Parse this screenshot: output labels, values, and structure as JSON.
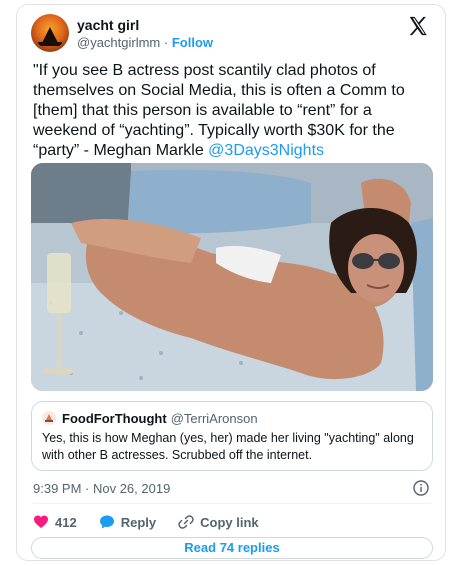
{
  "author": {
    "name": "yacht girl",
    "handle": "@yachtgirlmm",
    "separator": "·",
    "follow_label": "Follow"
  },
  "tweet": {
    "text": "\"If you see B actress post scantily clad photos of themselves on Social Media, this is often a Comm to [them] that this person is available to “rent” for a weekend of “yachting”. Typically worth $30K for the “party” - Meghan Markle ",
    "mention": "@3Days3Nights"
  },
  "quoted_tweet": {
    "name": "FoodForThought",
    "handle": "@TerriAronson",
    "text": "Yes, this is how Meghan (yes, her) made her living \"yachting\" along with other B actresses. Scrubbed off the internet."
  },
  "meta": {
    "timestamp": "9:39 PM · Nov 26, 2019"
  },
  "actions": {
    "like_count": "412",
    "reply_label": "Reply",
    "copy_link_label": "Copy link"
  },
  "read_replies_label": "Read 74 replies",
  "colors": {
    "accent": "#1d9bf0",
    "like": "#f91880",
    "text": "#0f1419",
    "secondary": "#536471"
  }
}
